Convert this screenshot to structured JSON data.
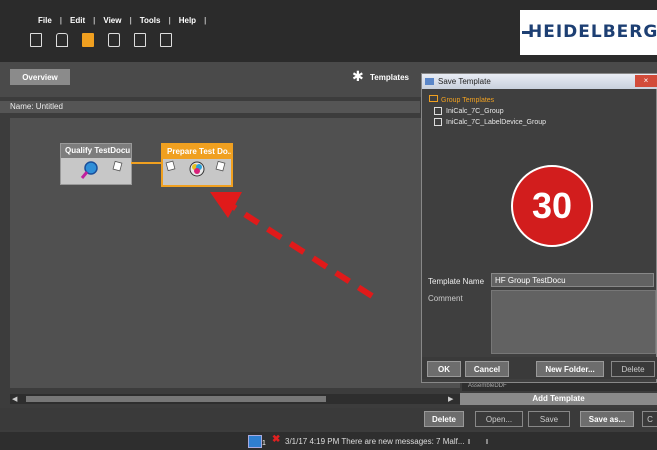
{
  "menu": [
    "File",
    "Edit",
    "View",
    "Tools",
    "Help"
  ],
  "toolbar_icons": [
    "document-icon",
    "plugin-icon",
    "queue-icon",
    "printer-icon",
    "check-document-icon",
    "save-icon"
  ],
  "logo": "HEIDELBERG",
  "overview_tab": "Overview",
  "templates_label": "Templates",
  "name_label": "Name: Untitled",
  "nodes": [
    {
      "title": "Qualify TestDocu"
    },
    {
      "title": "Prepare Test Do..."
    }
  ],
  "dialog": {
    "title": "Save Template",
    "close": "×",
    "tree_root": "Group Templates",
    "tree_items": [
      "IniCalc_7C_Group",
      "IniCalc_7C_LabelDevice_Group"
    ],
    "template_name_label": "Template Name",
    "template_name_value": "HF Group TestDocu",
    "comment_label": "Comment",
    "buttons": {
      "ok": "OK",
      "cancel": "Cancel",
      "new_folder": "New Folder...",
      "delete": "Delete"
    }
  },
  "step_badge": "30",
  "behind_dialog": {
    "add_template": "Add Template",
    "partial_text": "AssembleDDF"
  },
  "bottom_buttons": {
    "delete": "Delete",
    "open": "Open...",
    "save": "Save",
    "save_as": "Save as...",
    "cut": "C"
  },
  "statusbar": {
    "count": "1",
    "message": "3/1/17 4:19 PM  There are new messages: 7 Malf..."
  },
  "colors": {
    "accent": "#f0a020",
    "arrow": "#e01a1a",
    "badge": "#d21d1d",
    "logo": "#1d3f73"
  }
}
